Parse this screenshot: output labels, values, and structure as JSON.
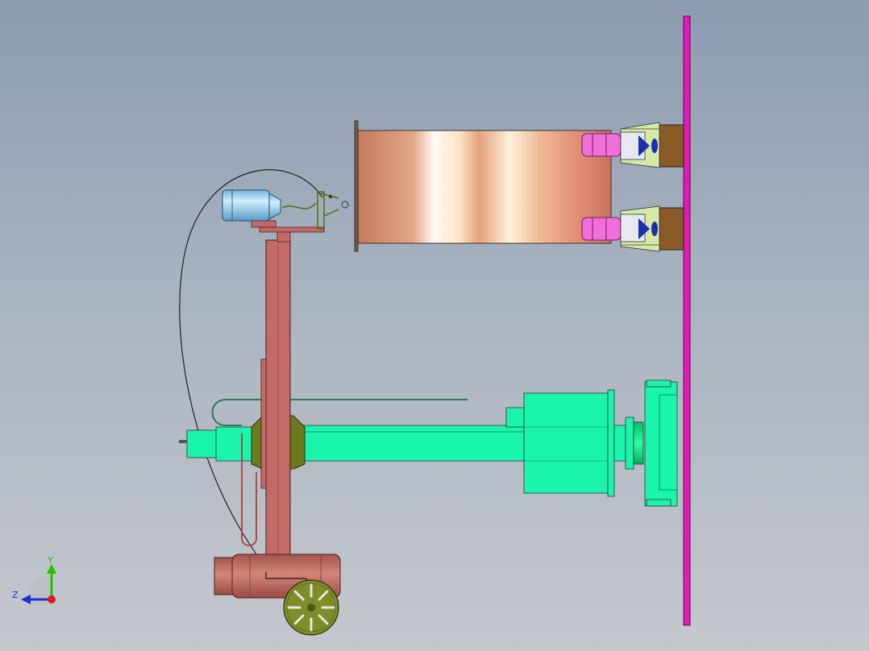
{
  "viewport": {
    "background_top": "#8c9cb1",
    "background_bottom": "#c5c8cd"
  },
  "triad": {
    "y_label": "Y",
    "z_label": "Z",
    "y_color": "#22c400",
    "z_color": "#1a2fd6",
    "x_color": "#e8141e"
  },
  "colors": {
    "mast": "#c46a66",
    "boom": "#19f5ab",
    "plate": "#e21ab6",
    "cylinder_light": "#ffffff",
    "cylinder_dark": "#c9805e",
    "roller": "#f06fd9",
    "motor": "#8fd0f0",
    "olive": "#6b7a1e",
    "wheel": "#7e8d2a",
    "bracket": "#8a5a26"
  }
}
